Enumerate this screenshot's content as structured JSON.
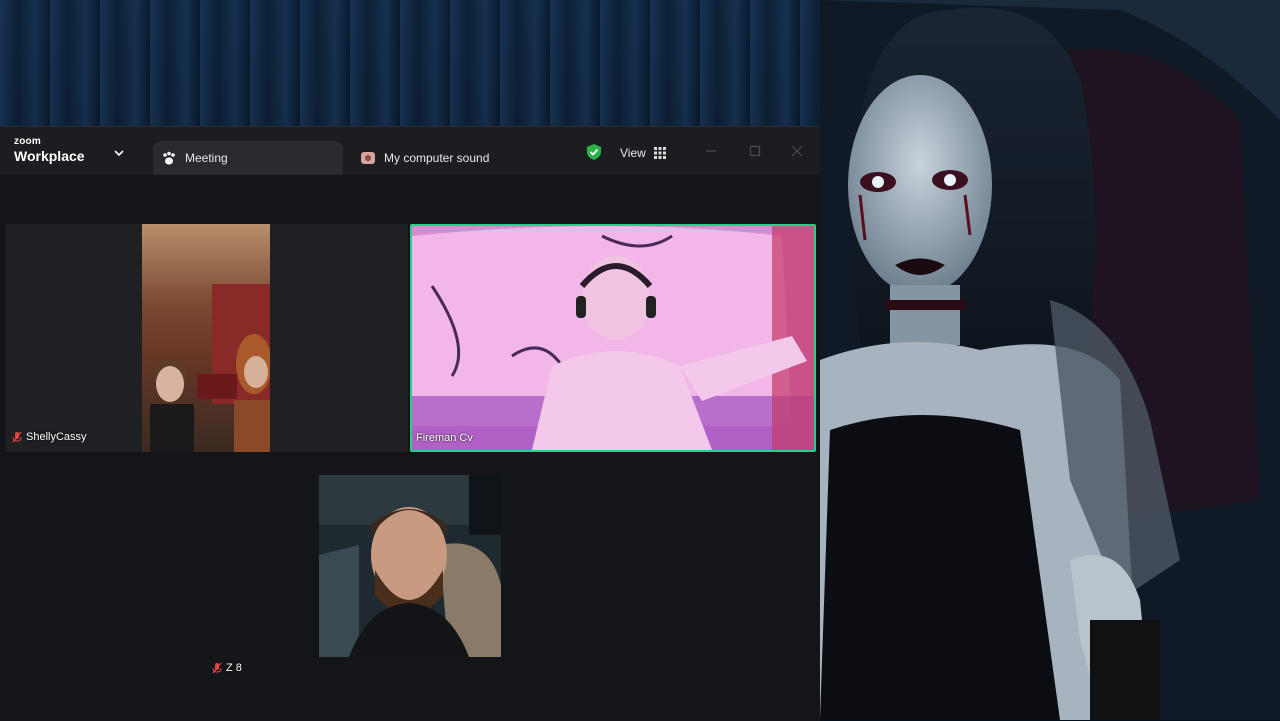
{
  "zoom": {
    "brand_top": "zoom",
    "brand_main": "Workplace",
    "tabs": [
      {
        "label": "Meeting"
      },
      {
        "label": "My computer sound"
      }
    ],
    "view_label": "View"
  },
  "participants": [
    {
      "name": "ShellyCassy",
      "muted": true
    },
    {
      "name": "Fireman Cv",
      "muted": false,
      "active_speaker": true
    },
    {
      "name": "Z 8",
      "muted": true
    }
  ],
  "colors": {
    "active_speaker_border": "#23d18b",
    "muted_icon": "#e0443e",
    "shield": "#2bb34a"
  }
}
